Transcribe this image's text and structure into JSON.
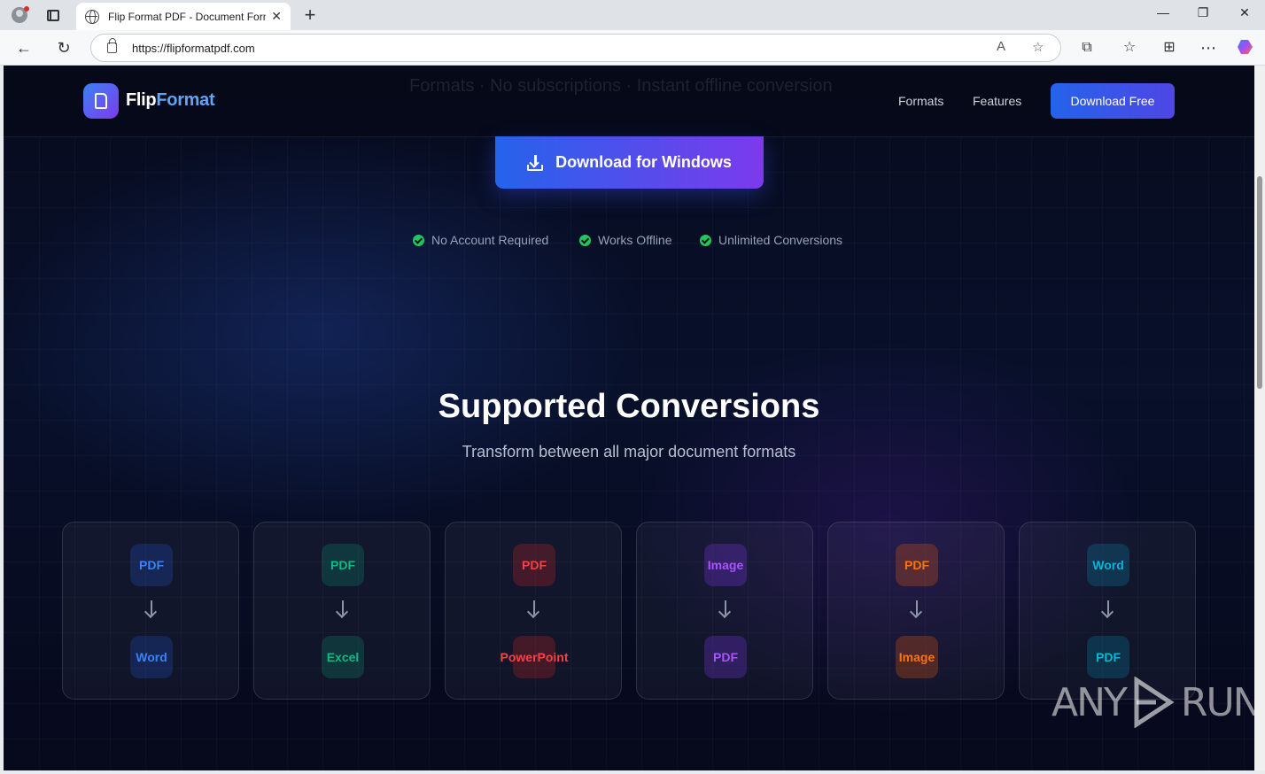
{
  "browser": {
    "tab_title": "Flip Format PDF - Document Form",
    "url": "https://flipformatpdf.com",
    "new_tab_symbol": "+",
    "close_symbol": "✕"
  },
  "site": {
    "ghost_text": "Formats · No subscriptions · Instant offline conversion",
    "logo_part1": "Flip",
    "logo_part2": "Format",
    "nav": [
      {
        "label": "Formats"
      },
      {
        "label": "Features"
      }
    ],
    "download_free": "Download Free",
    "download_windows": "Download for Windows",
    "features": [
      {
        "label": "No Account Required"
      },
      {
        "label": "Works Offline"
      },
      {
        "label": "Unlimited Conversions"
      }
    ],
    "section_title": "Supported Conversions",
    "section_subtitle": "Transform between all major document formats",
    "conversions": [
      {
        "from": "PDF",
        "to": "Word",
        "color": "#3b82f6"
      },
      {
        "from": "PDF",
        "to": "Excel",
        "color": "#10b981"
      },
      {
        "from": "PDF",
        "to": "PowerPoint",
        "color": "#ef4444"
      },
      {
        "from": "Image",
        "to": "PDF",
        "color": "#a855f7"
      },
      {
        "from": "PDF",
        "to": "Image",
        "color": "#f97316"
      },
      {
        "from": "Word",
        "to": "PDF",
        "color": "#06b6d4"
      }
    ],
    "watermark": "ANY RUN"
  }
}
